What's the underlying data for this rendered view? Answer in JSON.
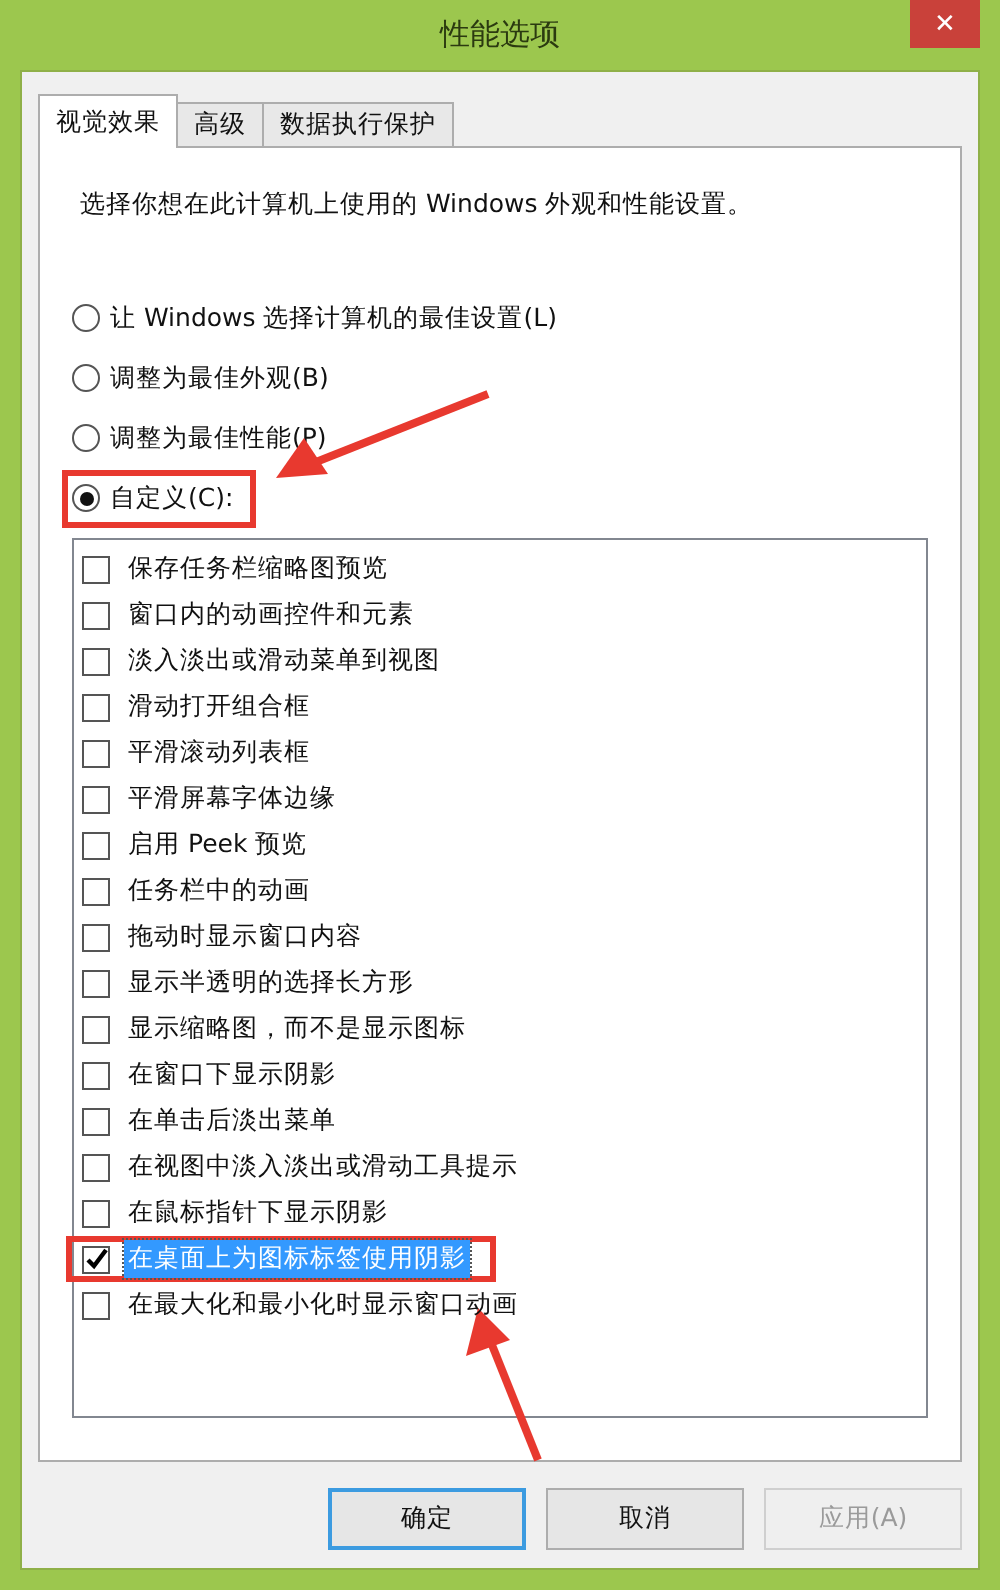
{
  "window": {
    "title": "性能选项",
    "close_label": "✕"
  },
  "tabs": [
    {
      "label": "视觉效果",
      "selected": true
    },
    {
      "label": "高级",
      "selected": false
    },
    {
      "label": "数据执行保护",
      "selected": false
    }
  ],
  "intro": "选择你想在此计算机上使用的 Windows 外观和性能设置。",
  "radios": [
    {
      "label": "让 Windows 选择计算机的最佳设置(L)",
      "selected": false,
      "highlighted": false
    },
    {
      "label": "调整为最佳外观(B)",
      "selected": false,
      "highlighted": false
    },
    {
      "label": "调整为最佳性能(P)",
      "selected": false,
      "highlighted": false
    },
    {
      "label": "自定义(C):",
      "selected": true,
      "highlighted": true
    }
  ],
  "options": [
    {
      "label": "保存任务栏缩略图预览",
      "checked": false,
      "selected": false,
      "highlighted": false
    },
    {
      "label": "窗口内的动画控件和元素",
      "checked": false,
      "selected": false,
      "highlighted": false
    },
    {
      "label": "淡入淡出或滑动菜单到视图",
      "checked": false,
      "selected": false,
      "highlighted": false
    },
    {
      "label": "滑动打开组合框",
      "checked": false,
      "selected": false,
      "highlighted": false
    },
    {
      "label": "平滑滚动列表框",
      "checked": false,
      "selected": false,
      "highlighted": false
    },
    {
      "label": "平滑屏幕字体边缘",
      "checked": false,
      "selected": false,
      "highlighted": false
    },
    {
      "label": "启用 Peek 预览",
      "checked": false,
      "selected": false,
      "highlighted": false
    },
    {
      "label": "任务栏中的动画",
      "checked": false,
      "selected": false,
      "highlighted": false
    },
    {
      "label": "拖动时显示窗口内容",
      "checked": false,
      "selected": false,
      "highlighted": false
    },
    {
      "label": "显示半透明的选择长方形",
      "checked": false,
      "selected": false,
      "highlighted": false
    },
    {
      "label": "显示缩略图，而不是显示图标",
      "checked": false,
      "selected": false,
      "highlighted": false
    },
    {
      "label": "在窗口下显示阴影",
      "checked": false,
      "selected": false,
      "highlighted": false
    },
    {
      "label": "在单击后淡出菜单",
      "checked": false,
      "selected": false,
      "highlighted": false
    },
    {
      "label": "在视图中淡入淡出或滑动工具提示",
      "checked": false,
      "selected": false,
      "highlighted": false
    },
    {
      "label": "在鼠标指针下显示阴影",
      "checked": false,
      "selected": false,
      "highlighted": false
    },
    {
      "label": "在桌面上为图标标签使用阴影",
      "checked": true,
      "selected": true,
      "highlighted": true
    },
    {
      "label": "在最大化和最小化时显示窗口动画",
      "checked": false,
      "selected": false,
      "highlighted": false
    }
  ],
  "buttons": [
    {
      "label": "确定",
      "default": true,
      "disabled": false
    },
    {
      "label": "取消",
      "default": false,
      "disabled": false
    },
    {
      "label": "应用(A)",
      "default": false,
      "disabled": true
    }
  ]
}
